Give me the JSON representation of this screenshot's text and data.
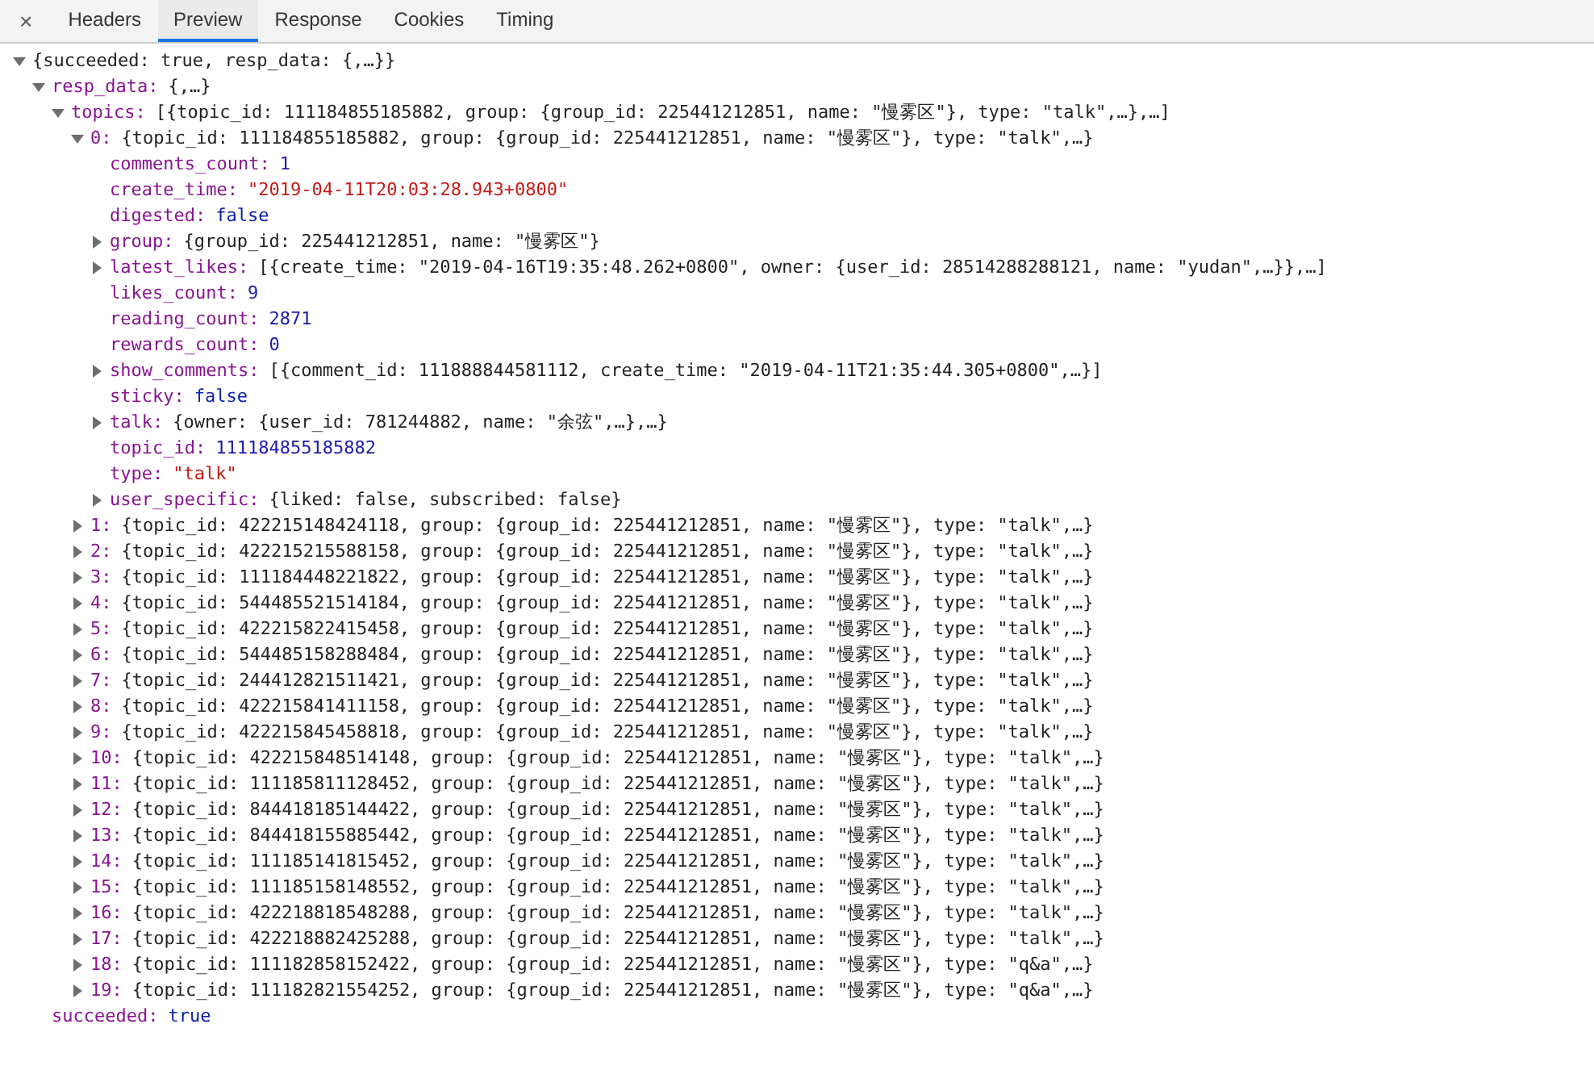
{
  "tabs": [
    {
      "label": "Headers",
      "selected": false
    },
    {
      "label": "Preview",
      "selected": true
    },
    {
      "label": "Response",
      "selected": false
    },
    {
      "label": "Cookies",
      "selected": false
    },
    {
      "label": "Timing",
      "selected": false
    }
  ],
  "close": "×",
  "tree": [
    {
      "text": "{succeeded: true, resp_data: {,…}}",
      "kind": "preview",
      "expanded": true,
      "children": [
        {
          "key": "resp_data:",
          "text": "{,…}",
          "kind": "preview",
          "expanded": true,
          "children": [
            {
              "key": "topics:",
              "text": "[{topic_id: 111184855185882, group: {group_id: 225441212851, name: \"慢雾区\"}, type: \"talk\",…},…]",
              "kind": "preview",
              "expanded": true,
              "children": [
                {
                  "key": "0:",
                  "text": "{topic_id: 111184855185882, group: {group_id: 225441212851, name: \"慢雾区\"}, type: \"talk\",…}",
                  "kind": "preview",
                  "expanded": true,
                  "children": [
                    {
                      "key": "comments_count:",
                      "text": "1",
                      "kind": "number"
                    },
                    {
                      "key": "create_time:",
                      "text": "\"2019-04-11T20:03:28.943+0800\"",
                      "kind": "string"
                    },
                    {
                      "key": "digested:",
                      "text": "false",
                      "kind": "boolean"
                    },
                    {
                      "key": "group:",
                      "text": "{group_id: 225441212851, name: \"慢雾区\"}",
                      "kind": "preview",
                      "expanded": false
                    },
                    {
                      "key": "latest_likes:",
                      "text": "[{create_time: \"2019-04-16T19:35:48.262+0800\", owner: {user_id: 28514288288121, name: \"yudan\",…}},…]",
                      "kind": "preview",
                      "expanded": false
                    },
                    {
                      "key": "likes_count:",
                      "text": "9",
                      "kind": "number"
                    },
                    {
                      "key": "reading_count:",
                      "text": "2871",
                      "kind": "number"
                    },
                    {
                      "key": "rewards_count:",
                      "text": "0",
                      "kind": "number"
                    },
                    {
                      "key": "show_comments:",
                      "text": "[{comment_id: 111888844581112, create_time: \"2019-04-11T21:35:44.305+0800\",…}]",
                      "kind": "preview",
                      "expanded": false
                    },
                    {
                      "key": "sticky:",
                      "text": "false",
                      "kind": "boolean"
                    },
                    {
                      "key": "talk:",
                      "text": "{owner: {user_id: 781244882, name: \"余弦\",…},…}",
                      "kind": "preview",
                      "expanded": false
                    },
                    {
                      "key": "topic_id:",
                      "text": "111184855185882",
                      "kind": "number"
                    },
                    {
                      "key": "type:",
                      "text": "\"talk\"",
                      "kind": "string"
                    },
                    {
                      "key": "user_specific:",
                      "text": "{liked: false, subscribed: false}",
                      "kind": "preview",
                      "expanded": false
                    }
                  ]
                },
                {
                  "key": "1:",
                  "text": "{topic_id: 422215148424118, group: {group_id: 225441212851, name: \"慢雾区\"}, type: \"talk\",…}",
                  "kind": "preview",
                  "expanded": false
                },
                {
                  "key": "2:",
                  "text": "{topic_id: 422215215588158, group: {group_id: 225441212851, name: \"慢雾区\"}, type: \"talk\",…}",
                  "kind": "preview",
                  "expanded": false
                },
                {
                  "key": "3:",
                  "text": "{topic_id: 111184448221822, group: {group_id: 225441212851, name: \"慢雾区\"}, type: \"talk\",…}",
                  "kind": "preview",
                  "expanded": false
                },
                {
                  "key": "4:",
                  "text": "{topic_id: 544485521514184, group: {group_id: 225441212851, name: \"慢雾区\"}, type: \"talk\",…}",
                  "kind": "preview",
                  "expanded": false
                },
                {
                  "key": "5:",
                  "text": "{topic_id: 422215822415458, group: {group_id: 225441212851, name: \"慢雾区\"}, type: \"talk\",…}",
                  "kind": "preview",
                  "expanded": false
                },
                {
                  "key": "6:",
                  "text": "{topic_id: 544485158288484, group: {group_id: 225441212851, name: \"慢雾区\"}, type: \"talk\",…}",
                  "kind": "preview",
                  "expanded": false
                },
                {
                  "key": "7:",
                  "text": "{topic_id: 244412821511421, group: {group_id: 225441212851, name: \"慢雾区\"}, type: \"talk\",…}",
                  "kind": "preview",
                  "expanded": false
                },
                {
                  "key": "8:",
                  "text": "{topic_id: 422215841411158, group: {group_id: 225441212851, name: \"慢雾区\"}, type: \"talk\",…}",
                  "kind": "preview",
                  "expanded": false
                },
                {
                  "key": "9:",
                  "text": "{topic_id: 422215845458818, group: {group_id: 225441212851, name: \"慢雾区\"}, type: \"talk\",…}",
                  "kind": "preview",
                  "expanded": false
                },
                {
                  "key": "10:",
                  "text": "{topic_id: 422215848514148, group: {group_id: 225441212851, name: \"慢雾区\"}, type: \"talk\",…}",
                  "kind": "preview",
                  "expanded": false
                },
                {
                  "key": "11:",
                  "text": "{topic_id: 111185811128452, group: {group_id: 225441212851, name: \"慢雾区\"}, type: \"talk\",…}",
                  "kind": "preview",
                  "expanded": false
                },
                {
                  "key": "12:",
                  "text": "{topic_id: 844418185144422, group: {group_id: 225441212851, name: \"慢雾区\"}, type: \"talk\",…}",
                  "kind": "preview",
                  "expanded": false
                },
                {
                  "key": "13:",
                  "text": "{topic_id: 844418155885442, group: {group_id: 225441212851, name: \"慢雾区\"}, type: \"talk\",…}",
                  "kind": "preview",
                  "expanded": false
                },
                {
                  "key": "14:",
                  "text": "{topic_id: 111185141815452, group: {group_id: 225441212851, name: \"慢雾区\"}, type: \"talk\",…}",
                  "kind": "preview",
                  "expanded": false
                },
                {
                  "key": "15:",
                  "text": "{topic_id: 111185158148552, group: {group_id: 225441212851, name: \"慢雾区\"}, type: \"talk\",…}",
                  "kind": "preview",
                  "expanded": false
                },
                {
                  "key": "16:",
                  "text": "{topic_id: 422218818548288, group: {group_id: 225441212851, name: \"慢雾区\"}, type: \"talk\",…}",
                  "kind": "preview",
                  "expanded": false
                },
                {
                  "key": "17:",
                  "text": "{topic_id: 422218882425288, group: {group_id: 225441212851, name: \"慢雾区\"}, type: \"talk\",…}",
                  "kind": "preview",
                  "expanded": false
                },
                {
                  "key": "18:",
                  "text": "{topic_id: 111182858152422, group: {group_id: 225441212851, name: \"慢雾区\"}, type: \"q&a\",…}",
                  "kind": "preview",
                  "expanded": false
                },
                {
                  "key": "19:",
                  "text": "{topic_id: 111182821554252, group: {group_id: 225441212851, name: \"慢雾区\"}, type: \"q&a\",…}",
                  "kind": "preview",
                  "expanded": false
                }
              ]
            }
          ]
        },
        {
          "key": "succeeded:",
          "text": "true",
          "kind": "boolean"
        }
      ]
    }
  ]
}
